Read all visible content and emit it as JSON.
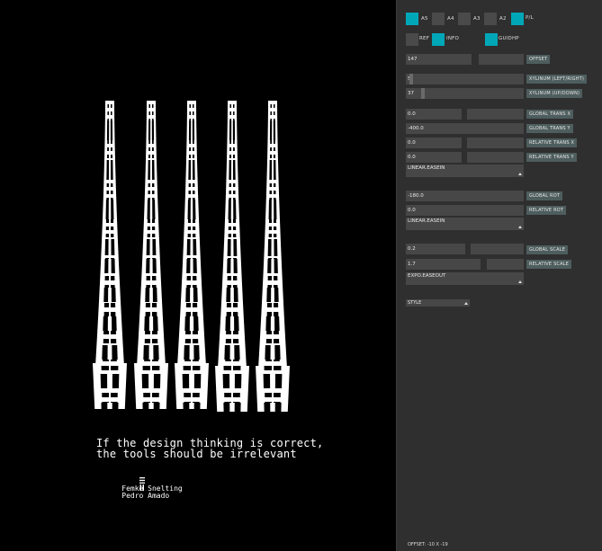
{
  "poster": {
    "quote_line1": "If the design thinking is correct,",
    "quote_line2": "the tools should be irrelevant",
    "author1": "Femke Snelting",
    "author2": "Pedro Amado",
    "author1_icon": "triple-bar-icon",
    "author2_icon": "double-bar-icon",
    "ink": "#ffffff",
    "background": "#000000"
  },
  "formats": [
    {
      "label": "A5",
      "active": true
    },
    {
      "label": "A4",
      "active": false
    },
    {
      "label": "A3",
      "active": false
    },
    {
      "label": "A2",
      "active": false
    },
    {
      "label": "P/L",
      "active": true
    }
  ],
  "toggles": [
    {
      "label": "REF",
      "active": false
    },
    {
      "label": "INFO",
      "active": true
    },
    {
      "label": "GUIDHP",
      "active": true
    }
  ],
  "offset": {
    "value": "147",
    "label": "OFFSET"
  },
  "xylinum_lr": {
    "value": "5",
    "label": "XYLINUM (LEFT/RIGHT)"
  },
  "xylinum_ud": {
    "value": "37",
    "label": "XYLINUM (UP/DOWN)"
  },
  "global_trans_x": {
    "value": "0.0",
    "label": "GLOBAL TRANS X"
  },
  "global_trans_y": {
    "value": "-400.0",
    "label": "GLOBAL TRANS Y"
  },
  "relative_trans_x": {
    "value": "0.0",
    "label": "RELATIVE TRANS X"
  },
  "relative_trans_y": {
    "value": "0.0",
    "label": "RELATIVE TRANS Y"
  },
  "ease1": {
    "value": "LINEAR.EASEIN"
  },
  "global_rot": {
    "value": "-180.0",
    "label": "GLOBAL ROT"
  },
  "relative_rot": {
    "value": "0.0",
    "label": "RELATIVE ROT"
  },
  "ease2": {
    "value": "LINEAR.EASEIN"
  },
  "global_scale": {
    "value": "0.2",
    "label": "GLOBAL SCALE"
  },
  "relative_scale": {
    "value": "1.7",
    "label": "RELATIVE SCALE"
  },
  "ease3": {
    "value": "EXPO.EASEOUT"
  },
  "style": {
    "value": "STYLE"
  },
  "status": "OFFSET: -10 X -19",
  "colors": {
    "panel": "#2f2f2f",
    "field": "#474747",
    "accent": "#00a7b7",
    "tag": "#4e5d5d"
  }
}
